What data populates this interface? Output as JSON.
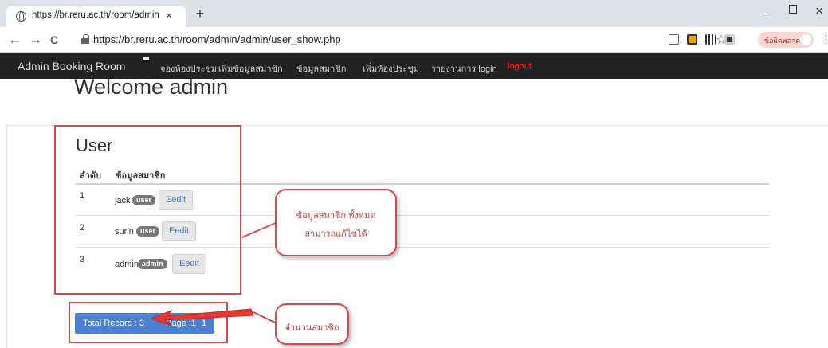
{
  "browser": {
    "tab_title": "https://br.reru.ac.th/room/admin",
    "tab_close": "×",
    "new_tab": "+",
    "url": "https://br.reru.ac.th/room/admin/admin/user_show.php",
    "profile_label": "ข้อผิดพลาด",
    "back": "←",
    "forward": "→",
    "reload": "C",
    "star": "☆",
    "min": "–",
    "close": "×",
    "menu": "⋮"
  },
  "navbar": {
    "brand": "Admin Booking Room",
    "items": [
      {
        "label": "จองห้องประชุม"
      },
      {
        "label": "เพิ่มข้อมูลสมาชิก"
      },
      {
        "label": "ข้อมูลสมาชิก"
      },
      {
        "label": "เพิ่มห้องประชุม"
      },
      {
        "label": "รายงานการ login"
      },
      {
        "label": "logout"
      }
    ]
  },
  "page": {
    "welcome": "Welcome admin",
    "heading": "User",
    "columns": [
      "ลำดับ",
      "ข้อมูลสมาชิก"
    ],
    "rows": [
      {
        "num": "1",
        "name": "jack",
        "badge": "user",
        "action": "Eedit"
      },
      {
        "num": "2",
        "name": "surin",
        "badge": "user",
        "action": "Eedit"
      },
      {
        "num": "3",
        "name": "admin",
        "badge": "admin",
        "action": "Eedit"
      }
    ],
    "pager": {
      "total": "Total Record : 3",
      "page": "Page :1",
      "num": "1"
    }
  },
  "annotations": {
    "callout_members": [
      "ข้อมูลสมาชิก ทั้งหมด",
      "สามารถแก้ไขได้"
    ],
    "callout_count": "จำนวนสมาชิก",
    "color": "#d9474a"
  },
  "colors": {
    "navbar_bg": "#222222",
    "pager_bg": "#4a80cf",
    "logout": "#ff2020",
    "badge": "#777777"
  }
}
